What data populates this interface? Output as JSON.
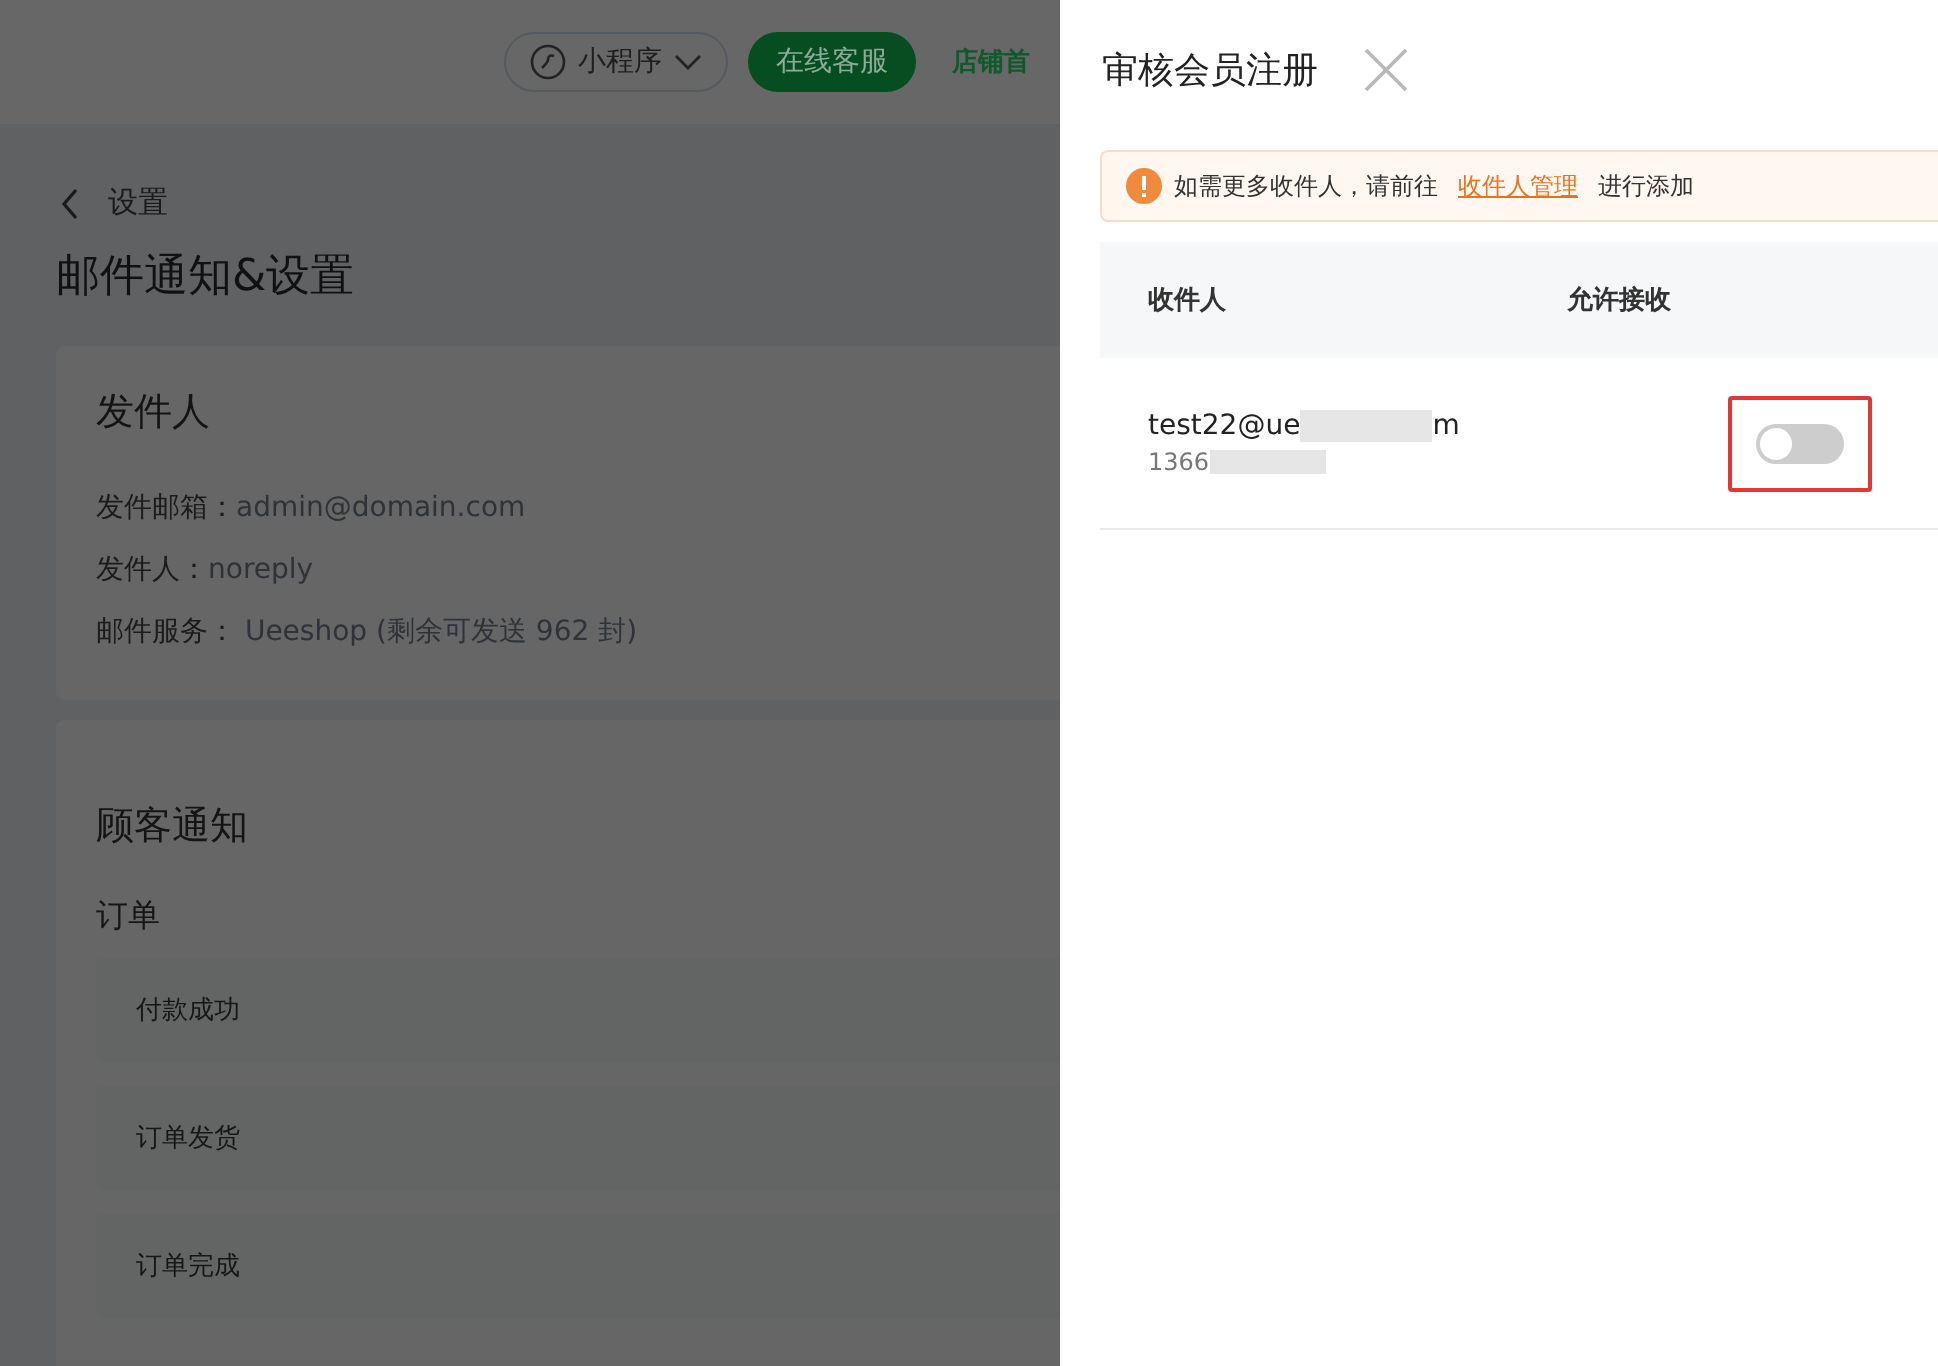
{
  "topbar": {
    "mini_program": "小程序",
    "support_button": "在线客服",
    "store_link": "店铺首"
  },
  "page": {
    "back_label": "设置",
    "title": "邮件通知&设置",
    "sender_card": {
      "title": "发件人",
      "lines": [
        {
          "label": "发件邮箱：",
          "value": "admin@domain.com"
        },
        {
          "label": "发件人：",
          "value": "noreply"
        },
        {
          "label": "邮件服务：",
          "value": " Ueeshop (剩余可发送 962 封)"
        }
      ]
    },
    "customer_card": {
      "title": "顾客通知",
      "section": "订单",
      "items": [
        "付款成功",
        "订单发货",
        "订单完成"
      ]
    }
  },
  "drawer": {
    "title": "审核会员注册",
    "alert": {
      "before": "如需更多收件人，请前往",
      "link": "收件人管理",
      "after": "进行添加"
    },
    "table": {
      "columns": [
        "收件人",
        "允许接收"
      ],
      "rows": [
        {
          "email_start": "test22@ue",
          "email_end": "m",
          "phone": "1366",
          "allowed": false,
          "highlighted": true
        }
      ]
    }
  }
}
